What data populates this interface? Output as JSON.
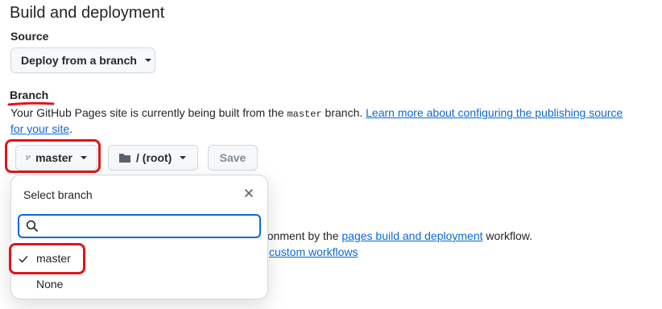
{
  "heading": "Build and deployment",
  "source": {
    "label": "Source",
    "dropdown_value": "Deploy from a branch"
  },
  "branch": {
    "label": "Branch",
    "desc_part1": "Your GitHub Pages site is currently being built from the ",
    "branch_code": "master",
    "desc_part2": " branch. ",
    "learn_more_line1": "Learn more about configuring the publishing source",
    "learn_more_line2": "for your site",
    "desc_end": ".",
    "branch_button": "master",
    "folder_button": "/ (root)",
    "save_button": "Save"
  },
  "behind": {
    "line1_prefix": "ironment by the ",
    "line1_link": "pages build and deployment",
    "line1_suffix": " workflow.",
    "line2_link": "custom workflows"
  },
  "popover": {
    "title": "Select branch",
    "search_value": "",
    "search_placeholder": "",
    "options": [
      {
        "label": "master",
        "selected": true
      },
      {
        "label": "None",
        "selected": false
      }
    ]
  },
  "annotation_color": "#e0151a",
  "accent_color": "#0969da"
}
